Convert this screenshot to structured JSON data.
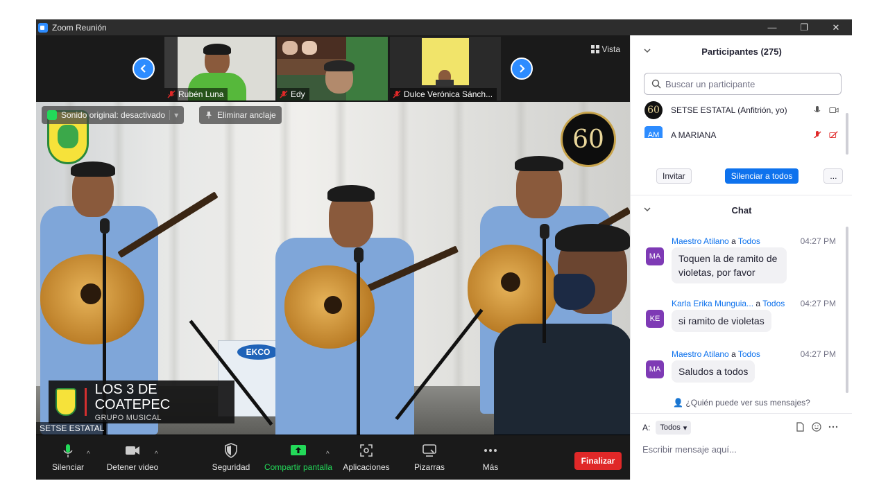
{
  "window": {
    "title": "Zoom Reunión",
    "controls": [
      "—",
      "❐",
      "✕"
    ]
  },
  "filmstrip": {
    "participants": [
      {
        "name": "Rubén Luna",
        "muted": true
      },
      {
        "name": "Edy",
        "muted": true
      },
      {
        "name": "Dulce Verónica Sánch...",
        "muted": true
      }
    ],
    "view_label": "Vista"
  },
  "main_video": {
    "original_sound": "Sonido original: desactivado",
    "unpin": "Eliminar anclaje",
    "logo_60": "60",
    "caption_title": "LOS 3 DE COATEPEC",
    "caption_subtitle": "GRUPO MUSICAL",
    "self_name": "SETSE ESTATAL"
  },
  "toolbar": {
    "mute": "Silenciar",
    "stop_video": "Detener video",
    "security": "Seguridad",
    "share": "Compartir pantalla",
    "apps": "Aplicaciones",
    "whiteboards": "Pizarras",
    "more": "Más",
    "end": "Finalizar"
  },
  "participants_panel": {
    "title": "Participantes (275)",
    "search_placeholder": "Buscar un participante",
    "list": [
      {
        "avatar": "60",
        "name": "SETSE ESTATAL (Anfitrión, yo)",
        "color": "#111111"
      },
      {
        "avatar": "AM",
        "name": "A MARIANA",
        "color": "#2d8cff"
      }
    ],
    "invite": "Invitar",
    "mute_all": "Silenciar a todos",
    "more": "..."
  },
  "chat": {
    "title": "Chat",
    "to_word": "a",
    "messages": [
      {
        "initials": "MA",
        "sender": "Maestro Atilano",
        "to": "Todos",
        "time": "04:27 PM",
        "text": "Toquen la de ramito de violetas, por favor"
      },
      {
        "initials": "KE",
        "sender": "Karla Erika Munguia...",
        "to": "Todos",
        "time": "04:27 PM",
        "text": "si ramito de violetas"
      },
      {
        "initials": "MA",
        "sender": "Maestro Atilano",
        "to": "Todos",
        "time": "04:27 PM",
        "text": "Saludos a todos"
      }
    ],
    "who_can_see": "¿Quién puede ver sus mensajes?",
    "to_label": "A:",
    "to_value": "Todos",
    "compose_placeholder": "Escribir mensaje aquí..."
  },
  "colors": {
    "accent": "#0e72ed",
    "end": "#e02828",
    "share_green": "#23d959",
    "avatar_purple": "#7e3ab5"
  }
}
